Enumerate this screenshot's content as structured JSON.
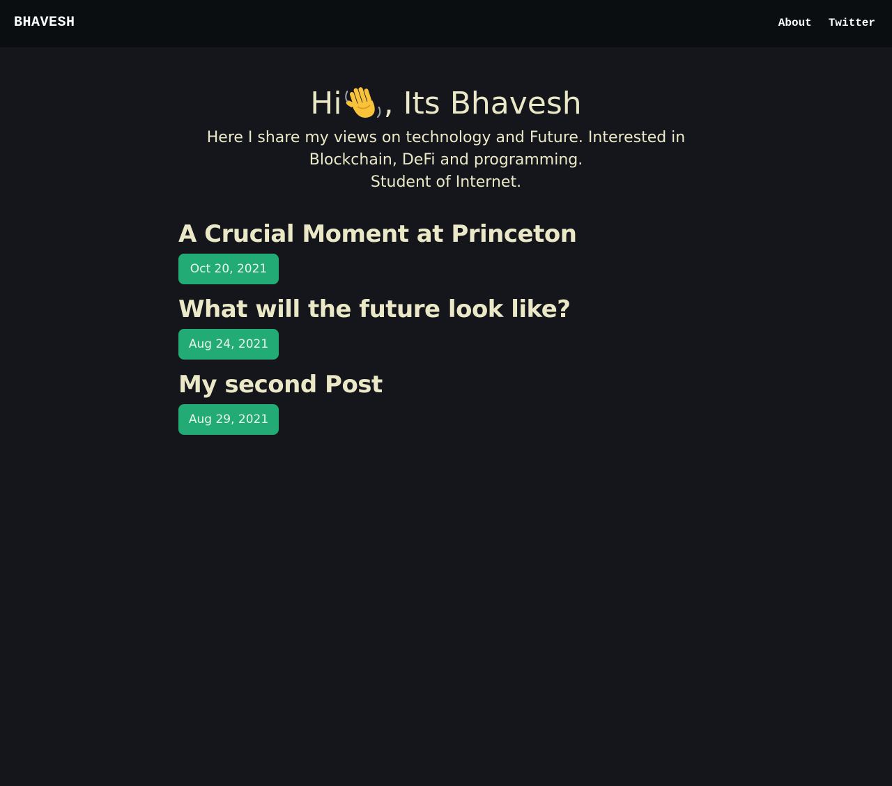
{
  "nav": {
    "brand": "BHAVESH",
    "links": [
      {
        "label": "About"
      },
      {
        "label": "Twitter"
      }
    ]
  },
  "hero": {
    "greeting_before": "Hi",
    "greeting_after": ", Its Bhavesh",
    "wave_icon": "waving-hand-emoji",
    "line1": "Here I share my views on technology and Future. Interested in Blockchain, DeFi and programming.",
    "line2": "Student of Internet."
  },
  "posts": [
    {
      "title": "A Crucial Moment at Princeton",
      "date": "Oct 20, 2021"
    },
    {
      "title": "What will the future look like?",
      "date": "Aug 24, 2021"
    },
    {
      "title": "My second Post",
      "date": "Aug 29, 2021"
    }
  ],
  "colors": {
    "background": "#14161b",
    "navbar": "#0b0e11",
    "text": "#ebe8c8",
    "date_badge": "#22ab75"
  }
}
